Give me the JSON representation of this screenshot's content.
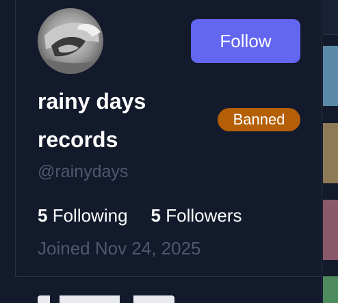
{
  "profile": {
    "display_name": "rainy days records",
    "handle": "@rainydays",
    "status_badge": "Banned",
    "follow_label": "Follow",
    "following_count": "5",
    "following_label": "Following",
    "followers_count": "5",
    "followers_label": "Followers",
    "joined": "Joined Nov 24, 2025",
    "avatar_icon": "profile-photo"
  },
  "colors": {
    "background": "#131a2b",
    "accent": "#6366f1",
    "badge": "#b45f06",
    "muted_text": "#4e5870",
    "border": "#2b3347"
  }
}
